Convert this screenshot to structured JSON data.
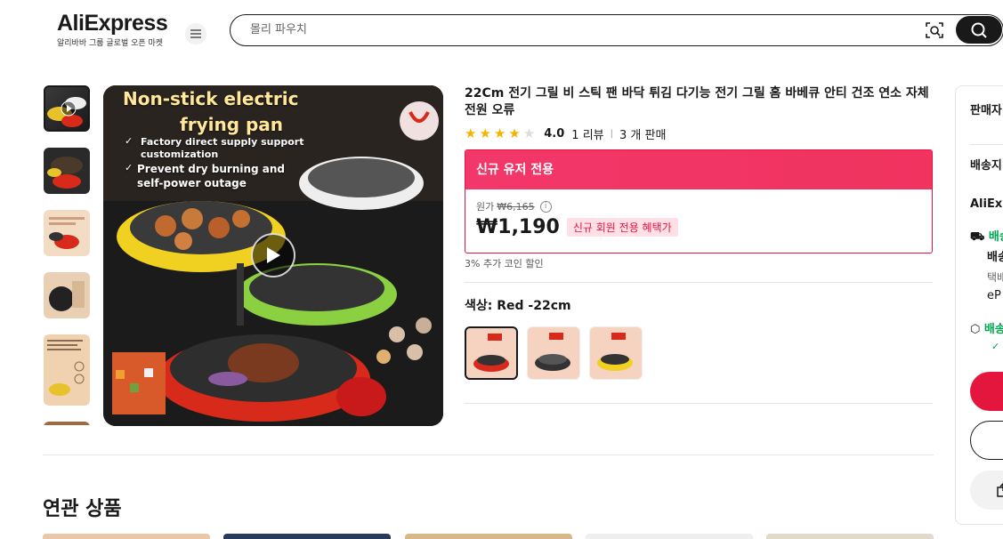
{
  "header": {
    "logo": "AliExpress",
    "logo_tagline": "알리바바 그룹 글로벌 오픈 마켓",
    "search_placeholder": "몰리 파우치"
  },
  "product": {
    "title": "22Cm 전기 그릴 비 스틱 팬 바닥 튀김 다기능 전기 그릴 홈 바베큐 안티 건조 연소 자체 전원 오류",
    "rating": "4.0",
    "rating_value": 4.0,
    "reviews": "1 리뷰",
    "sold": "3 개 판매",
    "promo_header": "신규 유저 전용",
    "original_label": "원가",
    "original_price": "₩6,165",
    "price": "₩1,190",
    "price_badge": "신규 회원 전용 혜택가",
    "coin_text": "3% 추가 코인 할인",
    "color_label": "색상: Red -22cm",
    "colors": [
      "Red -22cm",
      "Black -22cm",
      "Yellow -22cm"
    ]
  },
  "main_image": {
    "line1": "Non-stick electric",
    "line2": "frying pan",
    "bullet1a": "Factory direct supply support",
    "bullet1b": "customization",
    "bullet2a": "Prevent dry burning and",
    "bullet2b": "self-power outage"
  },
  "right_panel": {
    "seller": "판매자",
    "shipping": "배송지",
    "aliexpress": "AliExp",
    "ship1": "배송",
    "ship2": "배송",
    "parcel": "택배",
    "ep": "eP",
    "ship3": "배송"
  },
  "related": {
    "title": "연관 상품"
  },
  "colors": {
    "accent": "#e5163d",
    "promo_bg": "#f2376a",
    "star": "#f5b400"
  }
}
